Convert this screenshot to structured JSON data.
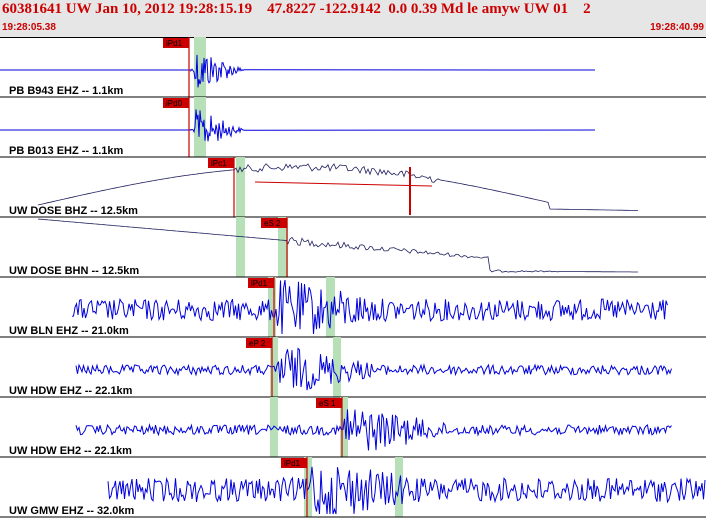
{
  "header": {
    "title": "60381641 UW Jan 10, 2012 19:28:15.19    47.8227 -122.9142  0.0 0.39 Md le amyw UW 01    2",
    "time_start": "19:28:05.38",
    "time_end": "19:28:40.99"
  },
  "colors": {
    "header_text": "#cc0000",
    "trace": "#0000dd",
    "trace_dark": "#202060",
    "pick": "#cc0000",
    "window": "#b8e0b8"
  },
  "traces": [
    {
      "label": "PB B943 EHZ -- 1.1km",
      "pick": "iPd1"
    },
    {
      "label": "PB B013 EHZ -- 1.1km",
      "pick": "iPd0"
    },
    {
      "label": "UW DOSE BHZ -- 12.5km",
      "pick": "iPc1"
    },
    {
      "label": "UW DOSE BHN -- 12.5km",
      "pick": "eS 2"
    },
    {
      "label": "UW BLN EHZ -- 21.0km",
      "pick": "iPd1"
    },
    {
      "label": "UW HDW EHZ -- 22.1km",
      "pick": "eP 2"
    },
    {
      "label": "UW HDW EH2 -- 22.1km",
      "pick": "eS 1"
    },
    {
      "label": "UW GMW EHZ -- 32.0km",
      "pick": "iPd1"
    }
  ]
}
